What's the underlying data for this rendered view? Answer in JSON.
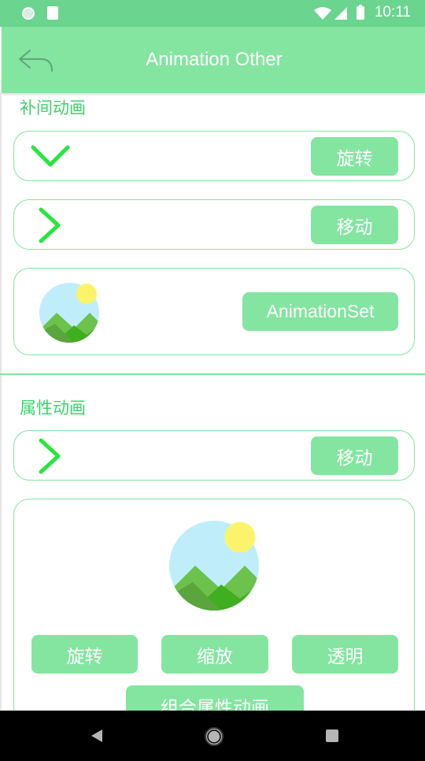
{
  "status_bar": {
    "time": "10:11"
  },
  "app_bar": {
    "title": "Animation Other"
  },
  "tween_section": {
    "header": "补间动画",
    "rotate_label": "旋转",
    "move_label": "移动",
    "set_label": "AnimationSet"
  },
  "property_section": {
    "header": "属性动画",
    "move_label": "移动",
    "rotate_label": "旋转",
    "scale_label": "缩放",
    "alpha_label": "透明",
    "combined_label": "组合属性动画"
  },
  "colors": {
    "primary": "#83e5a0",
    "accent_text": "#3ed16b",
    "chevron": "#27e63c"
  }
}
